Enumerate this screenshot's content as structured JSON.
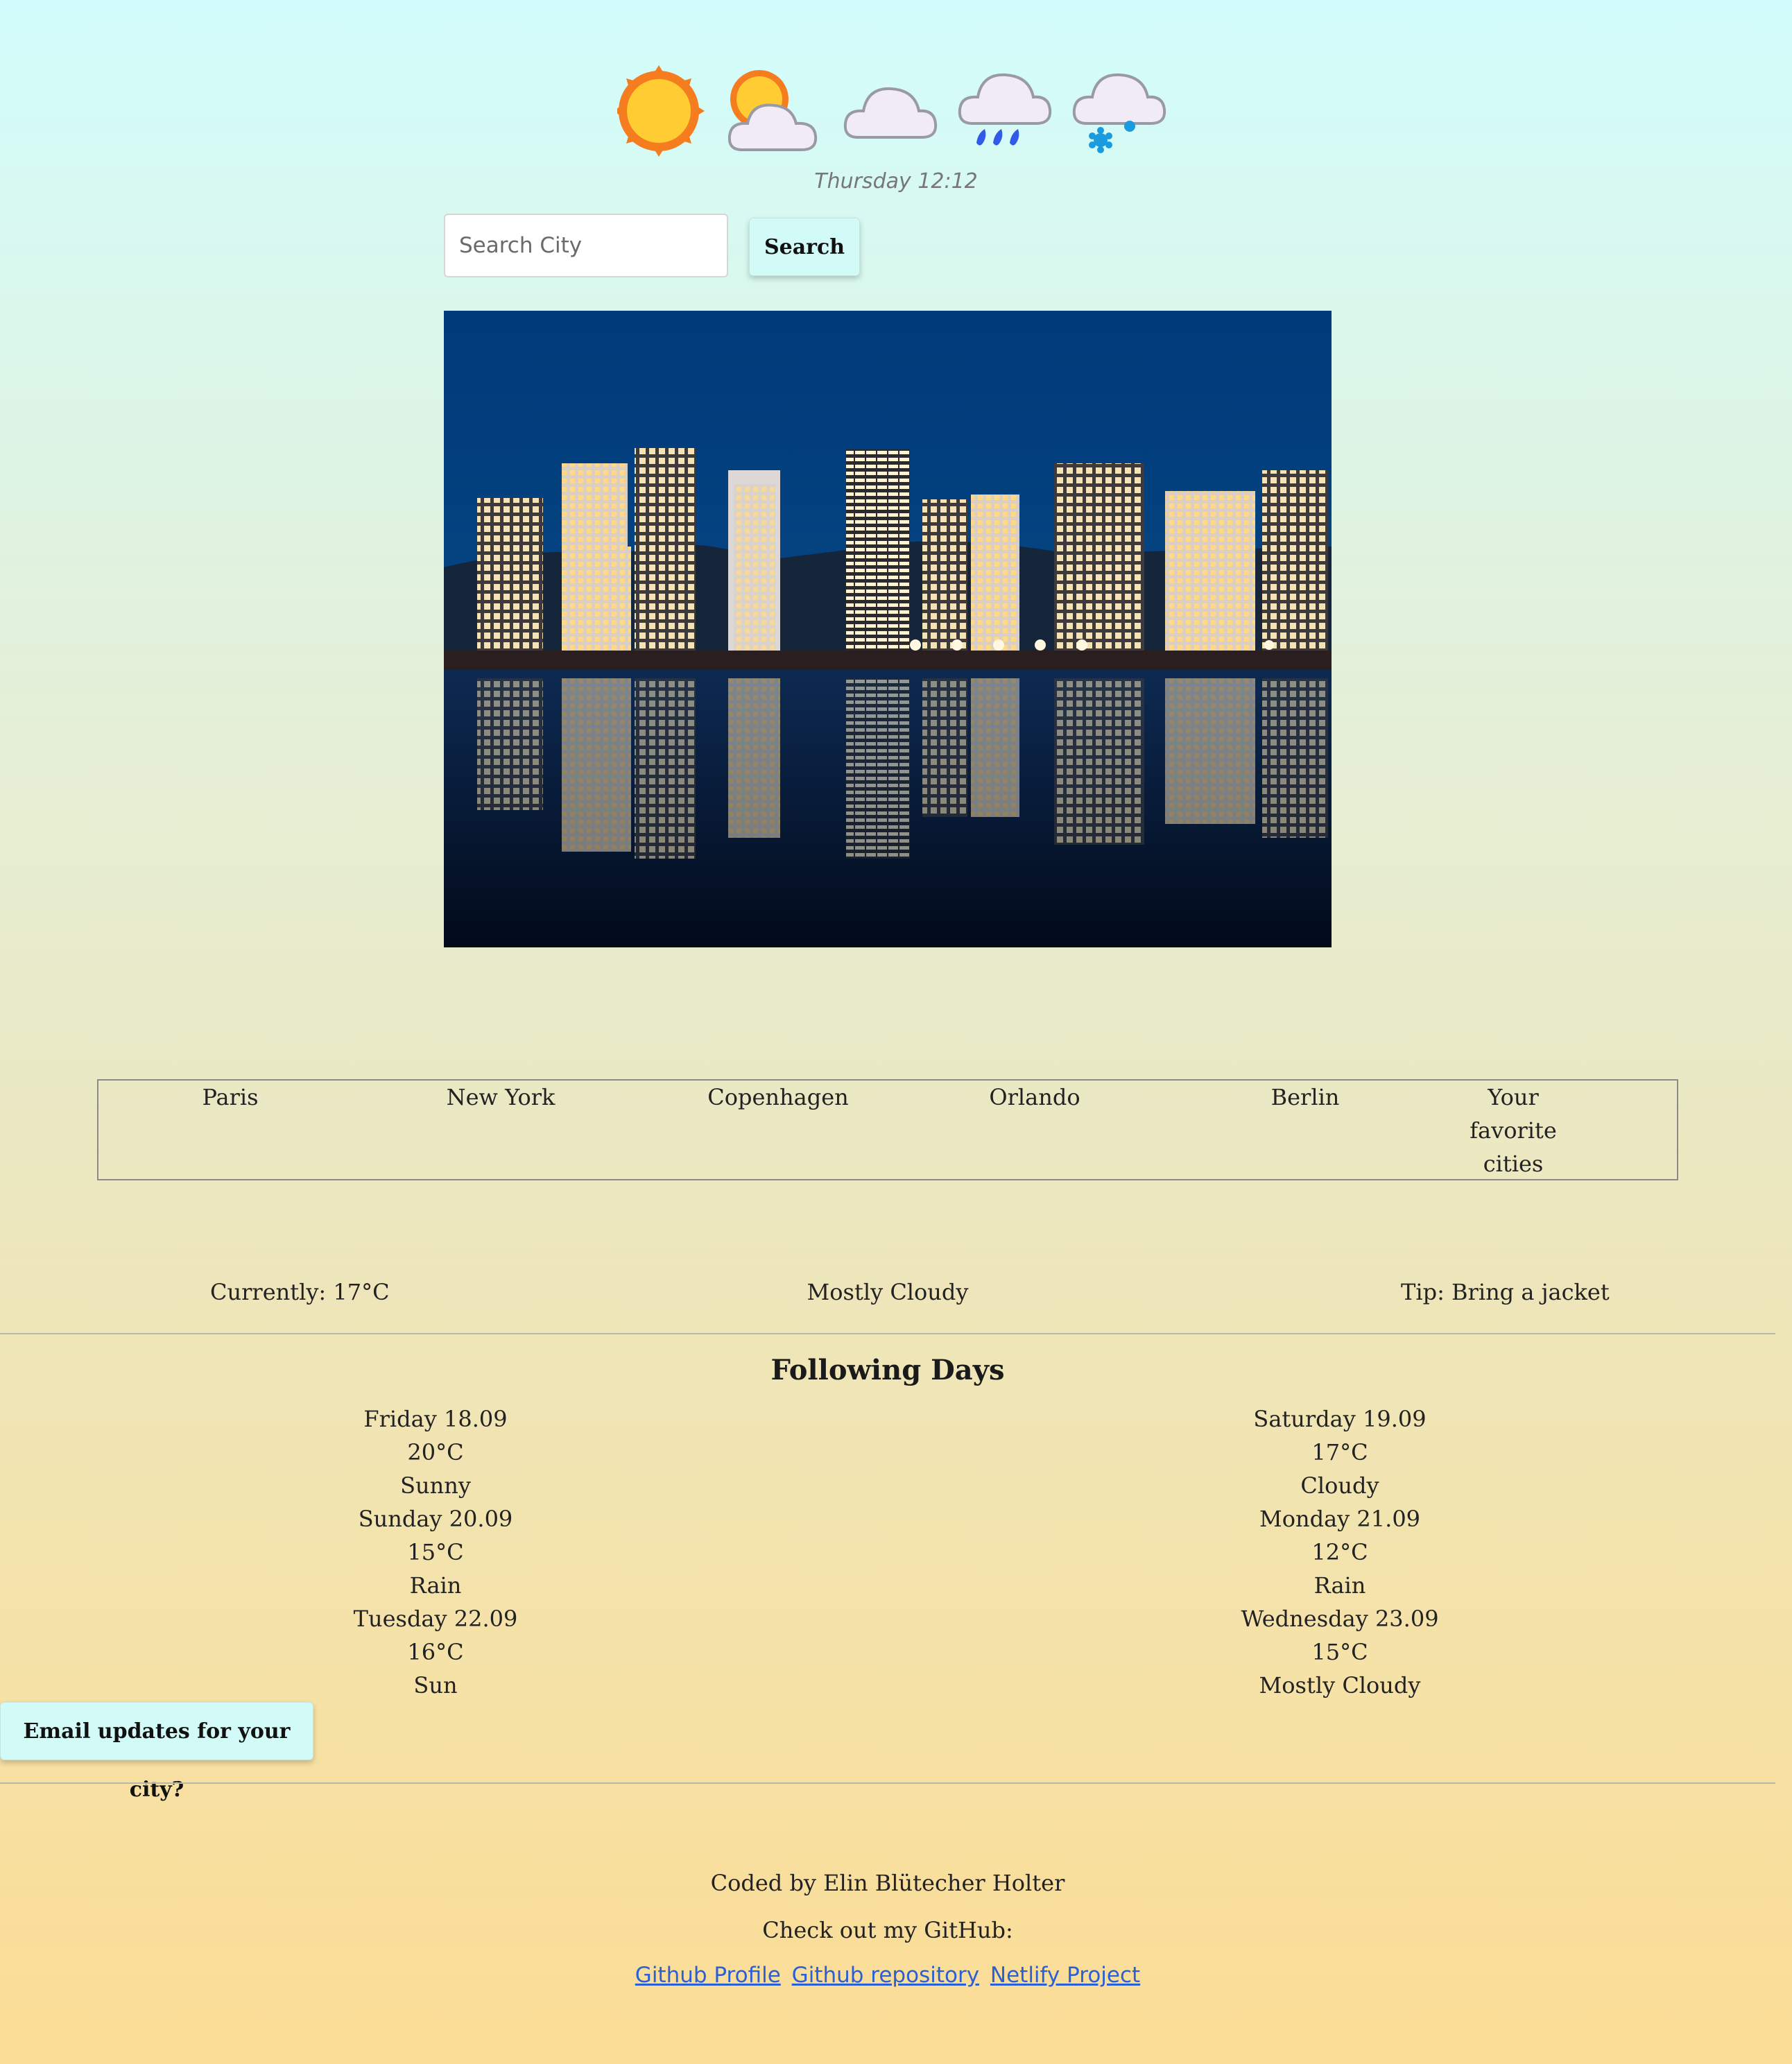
{
  "weather_icons": [
    "sun-icon",
    "partly-cloudy-icon",
    "cloud-icon",
    "rain-icon",
    "snow-icon"
  ],
  "header": {
    "day_time": "Thursday 12:12"
  },
  "search": {
    "placeholder": "Search City",
    "button_label": "Search"
  },
  "favorites": {
    "cities": [
      "Paris",
      "New York",
      "Copenhagen",
      "Orlando",
      "Berlin"
    ],
    "caption_lines": [
      "Your",
      "favorite",
      "cities"
    ]
  },
  "current": {
    "temperature": "Currently: 17°C",
    "condition": "Mostly Cloudy",
    "tip": "Tip: Bring a jacket"
  },
  "forecast": {
    "title": "Following Days",
    "left": [
      {
        "day": "Friday 18.09",
        "temp": "20°C",
        "desc": "Sunny"
      },
      {
        "day": "Sunday 20.09",
        "temp": "15°C",
        "desc": "Rain"
      },
      {
        "day": "Tuesday 22.09",
        "temp": "16°C",
        "desc": "Sun"
      }
    ],
    "right": [
      {
        "day": "Saturday 19.09",
        "temp": "17°C",
        "desc": "Cloudy"
      },
      {
        "day": "Monday 21.09",
        "temp": "12°C",
        "desc": "Rain"
      },
      {
        "day": "Wednesday 23.09",
        "temp": "15°C",
        "desc": "Mostly Cloudy"
      }
    ]
  },
  "email": {
    "button_label": "Email updates for your city?"
  },
  "footer": {
    "credit": "Coded by Elin Blütecher Holter",
    "github_prompt": "Check out my GitHub:",
    "links": [
      "Github Profile",
      "Github repository",
      "Netlify Project"
    ]
  },
  "colors": {
    "accent_button": "#d2fbf8",
    "link": "#2b5fd6",
    "sun": "#ffcc33",
    "sun_outline": "#f57c1f",
    "rain": "#2f5be8",
    "snow": "#1a9be0"
  }
}
